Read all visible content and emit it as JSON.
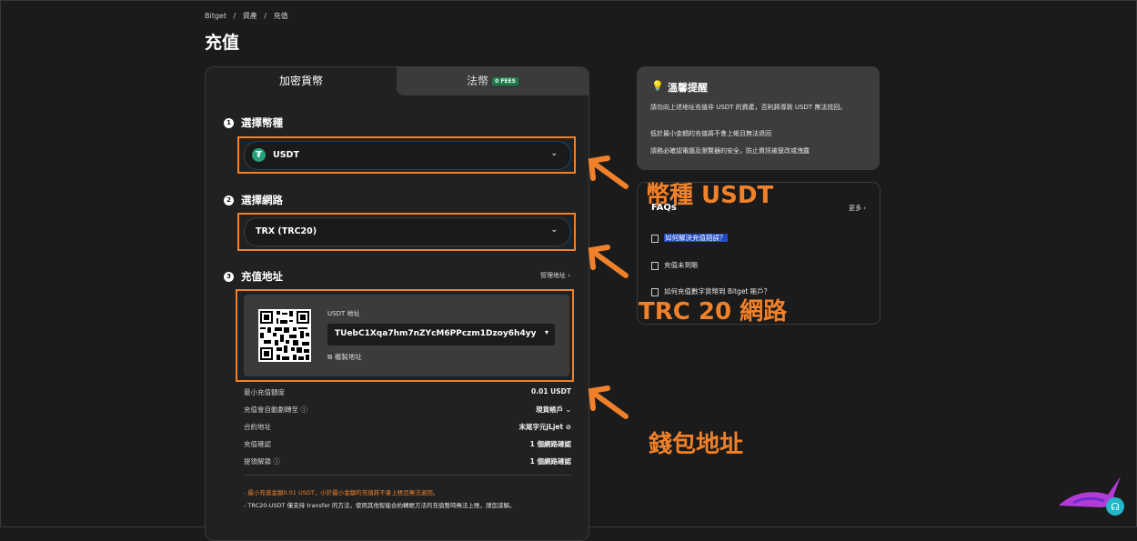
{
  "breadcrumb": [
    "Bitget",
    "/",
    "資產",
    "/",
    "充值"
  ],
  "page_title": "充值",
  "tabs": {
    "crypto": "加密貨幣",
    "fiat": "法幣",
    "fiat_badge": "0 FEES"
  },
  "step1": {
    "num": "1",
    "label": "選擇幣種",
    "value": "USDT",
    "icon": "tether-icon"
  },
  "step2": {
    "num": "2",
    "label": "選擇網路",
    "value": "TRX (TRC20)"
  },
  "step3": {
    "num": "3",
    "label": "充值地址",
    "manage": "管理地址 ›"
  },
  "address": {
    "label": "USDT 地址",
    "value": "TUebC1Xqa7hm7nZYcM6PPczm1Dzoy6h4yy",
    "copy": "複製地址"
  },
  "details": [
    {
      "k": "最小充值額度",
      "v": "0.01 USDT"
    },
    {
      "k": "充值會自動劃轉至 ⓘ",
      "v": "現貨帳戶 ⌄"
    },
    {
      "k": "合約地址",
      "v": "末尾字元jLjet ⊘"
    },
    {
      "k": "充值確認",
      "v": "1 個網路確認"
    },
    {
      "k": "提領解鎖 ⓘ",
      "v": "1 個網路確認"
    }
  ],
  "notes": [
    "- 最小充值金額0.01 USDT，小於最小金額的充值將不會上賬且無法退回。",
    "- TRC20-USDT 僅支持 transfer 的方法，使用其他智能合約轉賬方法的充值暫時無法上賬，請您諒解。"
  ],
  "tips": {
    "title": "溫馨提醒",
    "items": [
      "請勿向上述地址充值非 USDT 的資產，否則將導致 USDT 無法找回。",
      "低於最小金額的充值將不會上帳且無法退回",
      "請務必確認電腦及瀏覽器的安全，防止資訊被竄改或洩露"
    ]
  },
  "faq": {
    "title": "FAQs",
    "more": "更多 ›",
    "items": [
      "如何解決充值錯誤？",
      "充值未到賬",
      "如何充值數字貨幣到 Bitget 賬戶？"
    ]
  },
  "annotations": {
    "coin": "幣種 USDT",
    "network": "TRC 20 網路",
    "wallet": "錢包地址"
  },
  "colors": {
    "accent": "#f0812a",
    "tether": "#26a17b",
    "badge": "#1c7a4c"
  }
}
